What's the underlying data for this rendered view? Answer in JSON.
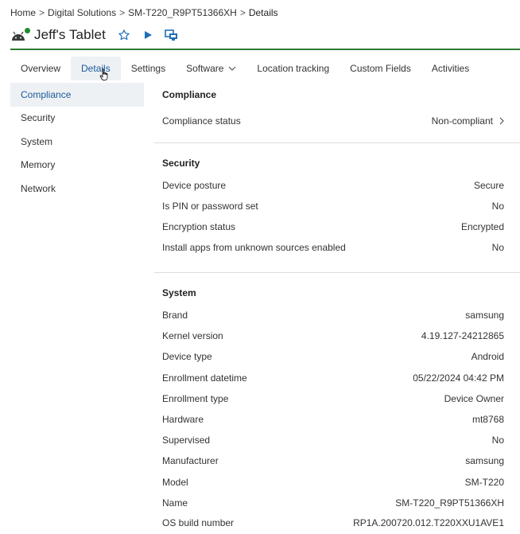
{
  "breadcrumb": {
    "items": [
      "Home",
      "Digital Solutions",
      "SM-T220_R9PT51366XH",
      "Details"
    ],
    "separator": ">"
  },
  "header": {
    "title": "Jeff's Tablet",
    "status_color": "#1e8a2e"
  },
  "tabs": [
    {
      "label": "Overview"
    },
    {
      "label": "Details",
      "active": true
    },
    {
      "label": "Settings"
    },
    {
      "label": "Software"
    },
    {
      "label": "Location tracking"
    },
    {
      "label": "Custom Fields"
    },
    {
      "label": "Activities"
    }
  ],
  "sidebar": {
    "items": [
      {
        "label": "Compliance",
        "active": true
      },
      {
        "label": "Security"
      },
      {
        "label": "System"
      },
      {
        "label": "Memory"
      },
      {
        "label": "Network"
      }
    ]
  },
  "compliance": {
    "title": "Compliance",
    "rows": [
      {
        "label": "Compliance status",
        "value": "Non-compliant"
      }
    ]
  },
  "security": {
    "title": "Security",
    "rows": [
      {
        "label": "Device posture",
        "value": "Secure"
      },
      {
        "label": "Is PIN or password set",
        "value": "No"
      },
      {
        "label": "Encryption status",
        "value": "Encrypted"
      },
      {
        "label": "Install apps from unknown sources enabled",
        "value": "No"
      }
    ]
  },
  "system": {
    "title": "System",
    "rows": [
      {
        "label": "Brand",
        "value": "samsung"
      },
      {
        "label": "Kernel version",
        "value": "4.19.127-24212865"
      },
      {
        "label": "Device type",
        "value": "Android"
      },
      {
        "label": "Enrollment datetime",
        "value": "05/22/2024 04:42 PM"
      },
      {
        "label": "Enrollment type",
        "value": "Device Owner"
      },
      {
        "label": "Hardware",
        "value": "mt8768"
      },
      {
        "label": "Supervised",
        "value": "No"
      },
      {
        "label": "Manufacturer",
        "value": "samsung"
      },
      {
        "label": "Model",
        "value": "SM-T220"
      },
      {
        "label": "Name",
        "value": "SM-T220_R9PT51366XH"
      },
      {
        "label": "OS build number",
        "value": "RP1A.200720.012.T220XXU1AVE1"
      }
    ]
  },
  "colors": {
    "accent": "#1a5a9a",
    "header_rule": "#2e7d32",
    "active_bg": "#eef1f4",
    "icon_blue": "#1f6fb5"
  }
}
